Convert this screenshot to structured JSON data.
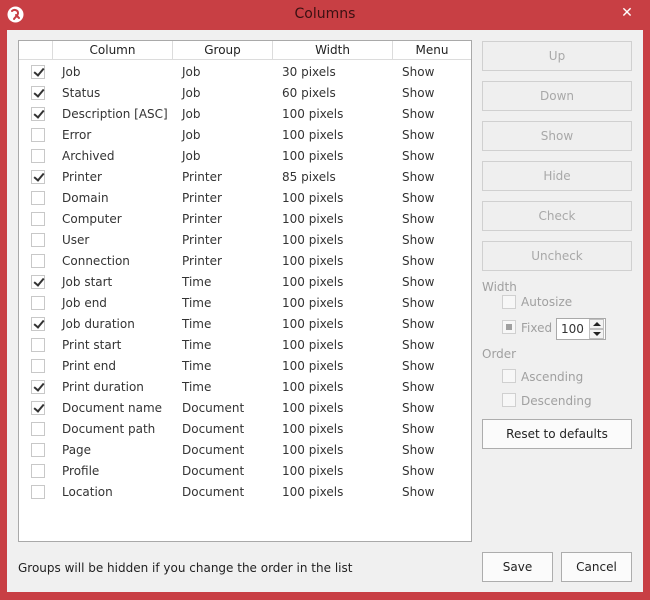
{
  "window": {
    "title": "Columns",
    "close_symbol": "✕",
    "accent_color": "#c83f44"
  },
  "list": {
    "headers": [
      "Column",
      "Group",
      "Width",
      "Menu"
    ],
    "rows": [
      {
        "checked": true,
        "column": "Job",
        "group": "Job",
        "width": "30 pixels",
        "menu": "Show"
      },
      {
        "checked": true,
        "column": "Status",
        "group": "Job",
        "width": "60 pixels",
        "menu": "Show"
      },
      {
        "checked": true,
        "column": "Description [ASC]",
        "group": "Job",
        "width": "100 pixels",
        "menu": "Show"
      },
      {
        "checked": false,
        "column": "Error",
        "group": "Job",
        "width": "100 pixels",
        "menu": "Show"
      },
      {
        "checked": false,
        "column": "Archived",
        "group": "Job",
        "width": "100 pixels",
        "menu": "Show"
      },
      {
        "checked": true,
        "column": "Printer",
        "group": "Printer",
        "width": "85 pixels",
        "menu": "Show"
      },
      {
        "checked": false,
        "column": "Domain",
        "group": "Printer",
        "width": "100 pixels",
        "menu": "Show"
      },
      {
        "checked": false,
        "column": "Computer",
        "group": "Printer",
        "width": "100 pixels",
        "menu": "Show"
      },
      {
        "checked": false,
        "column": "User",
        "group": "Printer",
        "width": "100 pixels",
        "menu": "Show"
      },
      {
        "checked": false,
        "column": "Connection",
        "group": "Printer",
        "width": "100 pixels",
        "menu": "Show"
      },
      {
        "checked": true,
        "column": "Job start",
        "group": "Time",
        "width": "100 pixels",
        "menu": "Show"
      },
      {
        "checked": false,
        "column": "Job end",
        "group": "Time",
        "width": "100 pixels",
        "menu": "Show"
      },
      {
        "checked": true,
        "column": "Job duration",
        "group": "Time",
        "width": "100 pixels",
        "menu": "Show"
      },
      {
        "checked": false,
        "column": "Print start",
        "group": "Time",
        "width": "100 pixels",
        "menu": "Show"
      },
      {
        "checked": false,
        "column": "Print end",
        "group": "Time",
        "width": "100 pixels",
        "menu": "Show"
      },
      {
        "checked": true,
        "column": "Print duration",
        "group": "Time",
        "width": "100 pixels",
        "menu": "Show"
      },
      {
        "checked": true,
        "column": "Document name",
        "group": "Document",
        "width": "100 pixels",
        "menu": "Show"
      },
      {
        "checked": false,
        "column": "Document path",
        "group": "Document",
        "width": "100 pixels",
        "menu": "Show"
      },
      {
        "checked": false,
        "column": "Page",
        "group": "Document",
        "width": "100 pixels",
        "menu": "Show"
      },
      {
        "checked": false,
        "column": "Profile",
        "group": "Document",
        "width": "100 pixels",
        "menu": "Show"
      },
      {
        "checked": false,
        "column": "Location",
        "group": "Document",
        "width": "100 pixels",
        "menu": "Show"
      }
    ]
  },
  "buttons": {
    "up": "Up",
    "down": "Down",
    "show": "Show",
    "hide": "Hide",
    "check": "Check",
    "uncheck": "Uncheck",
    "reset": "Reset to defaults",
    "save": "Save",
    "cancel": "Cancel"
  },
  "width_section": {
    "label": "Width",
    "autosize_label": "Autosize",
    "fixed_label": "Fixed",
    "fixed_value": "100"
  },
  "order_section": {
    "label": "Order",
    "ascending_label": "Ascending",
    "descending_label": "Descending"
  },
  "footer": {
    "note": "Groups will be hidden if you change the order in the list"
  }
}
